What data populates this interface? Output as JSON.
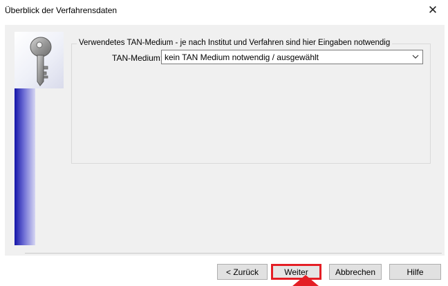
{
  "window": {
    "title": "Überblick der Verfahrensdaten",
    "close_glyph": "✕"
  },
  "group": {
    "legend": "Verwendetes TAN-Medium - je nach Institut und Verfahren sind hier Eingaben notwendig"
  },
  "tan_medium": {
    "label": "TAN-Medium:",
    "selected": "kein TAN Medium notwendig / ausgewählt"
  },
  "buttons": {
    "back": "< Zurück",
    "next": "Weiter",
    "cancel": "Abbrechen",
    "help": "Hilfe"
  },
  "icons": {
    "wizard_image": "key-icon",
    "dropdown": "chevron-down-icon",
    "annotation": "arrow-up-icon"
  },
  "colors": {
    "highlight": "#e41e25",
    "side_gradient_dark": "#1414a8"
  }
}
